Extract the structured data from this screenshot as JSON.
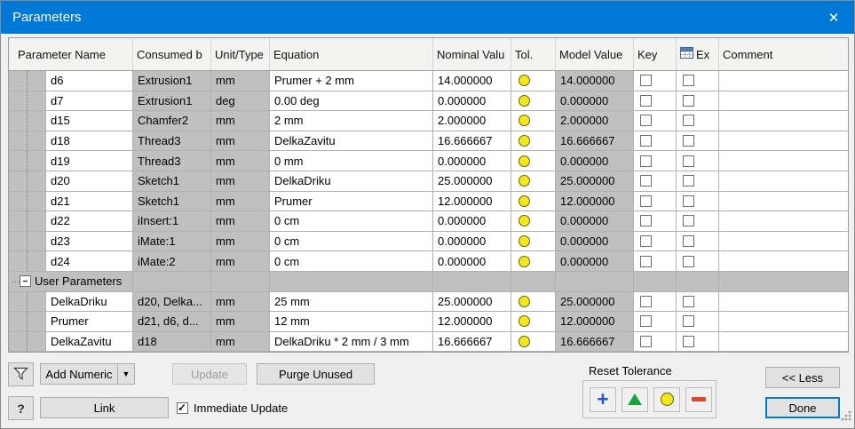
{
  "window": {
    "title": "Parameters",
    "close_glyph": "✕"
  },
  "colors": {
    "accent_blue": "#0078d7",
    "readonly_cell_gray": "#c0c0c0",
    "tolerance_yellow": "#f5e71e",
    "reset_plus_blue": "#2456cf",
    "reset_triangle_green": "#18a43a",
    "reset_minus_red": "#e2442c"
  },
  "icons": {
    "close": "close-icon",
    "filter": "funnel-icon",
    "help": "question-icon",
    "dropdown": "chevron-down-icon",
    "export_header": "export-table-icon",
    "tolerance": "yellow-circle-icon",
    "resize": "resize-grip-icon"
  },
  "table": {
    "headers": {
      "name": "Parameter Name",
      "consumed": "Consumed b",
      "unit": "Unit/Type",
      "equation": "Equation",
      "nominal": "Nominal Valu",
      "tol": "Tol.",
      "model": "Model Value",
      "key": "Key",
      "export": "Ex",
      "comment": "Comment"
    },
    "rows": [
      {
        "type": "param",
        "name": "d6",
        "consumed": "Extrusion1",
        "unit": "mm",
        "equation": "Prumer + 2 mm",
        "nominal": "14.000000",
        "tol": "yellow",
        "model": "14.000000",
        "key": false,
        "export": false,
        "comment": ""
      },
      {
        "type": "param",
        "name": "d7",
        "consumed": "Extrusion1",
        "unit": "deg",
        "equation": "0.00 deg",
        "nominal": "0.000000",
        "tol": "yellow",
        "model": "0.000000",
        "key": false,
        "export": false,
        "comment": ""
      },
      {
        "type": "param",
        "name": "d15",
        "consumed": "Chamfer2",
        "unit": "mm",
        "equation": "2 mm",
        "nominal": "2.000000",
        "tol": "yellow",
        "model": "2.000000",
        "key": false,
        "export": false,
        "comment": ""
      },
      {
        "type": "param",
        "name": "d18",
        "consumed": "Thread3",
        "unit": "mm",
        "equation": "DelkaZavitu",
        "nominal": "16.666667",
        "tol": "yellow",
        "model": "16.666667",
        "key": false,
        "export": false,
        "comment": ""
      },
      {
        "type": "param",
        "name": "d19",
        "consumed": "Thread3",
        "unit": "mm",
        "equation": "0 mm",
        "nominal": "0.000000",
        "tol": "yellow",
        "model": "0.000000",
        "key": false,
        "export": false,
        "comment": ""
      },
      {
        "type": "param",
        "name": "d20",
        "consumed": "Sketch1",
        "unit": "mm",
        "equation": "DelkaDriku",
        "nominal": "25.000000",
        "tol": "yellow",
        "model": "25.000000",
        "key": false,
        "export": false,
        "comment": ""
      },
      {
        "type": "param",
        "name": "d21",
        "consumed": "Sketch1",
        "unit": "mm",
        "equation": "Prumer",
        "nominal": "12.000000",
        "tol": "yellow",
        "model": "12.000000",
        "key": false,
        "export": false,
        "comment": ""
      },
      {
        "type": "param",
        "name": "d22",
        "consumed": "iInsert:1",
        "unit": "mm",
        "equation": "0 cm",
        "nominal": "0.000000",
        "tol": "yellow",
        "model": "0.000000",
        "key": false,
        "export": false,
        "comment": ""
      },
      {
        "type": "param",
        "name": "d23",
        "consumed": "iMate:1",
        "unit": "mm",
        "equation": "0 cm",
        "nominal": "0.000000",
        "tol": "yellow",
        "model": "0.000000",
        "key": false,
        "export": false,
        "comment": ""
      },
      {
        "type": "param",
        "name": "d24",
        "consumed": "iMate:2",
        "unit": "mm",
        "equation": "0 cm",
        "nominal": "0.000000",
        "tol": "yellow",
        "model": "0.000000",
        "key": false,
        "export": false,
        "comment": ""
      },
      {
        "type": "group",
        "name": "User Parameters",
        "expander": "-"
      },
      {
        "type": "param",
        "name": "DelkaDriku",
        "consumed": "d20, Delka...",
        "unit": "mm",
        "equation": "25 mm",
        "nominal": "25.000000",
        "tol": "yellow",
        "model": "25.000000",
        "key": false,
        "export": false,
        "comment": ""
      },
      {
        "type": "param",
        "name": "Prumer",
        "consumed": "d21, d6, d...",
        "unit": "mm",
        "equation": "12 mm",
        "nominal": "12.000000",
        "tol": "yellow",
        "model": "12.000000",
        "key": false,
        "export": false,
        "comment": ""
      },
      {
        "type": "param",
        "name": "DelkaZavitu",
        "consumed": "d18",
        "unit": "mm",
        "equation": "DelkaDriku * 2 mm / 3 mm",
        "nominal": "16.666667",
        "tol": "yellow",
        "model": "16.666667",
        "key": false,
        "export": false,
        "comment": ""
      }
    ]
  },
  "footer": {
    "add_numeric_label": "Add Numeric",
    "dropdown_glyph": "▼",
    "update_label": "Update",
    "purge_unused_label": "Purge Unused",
    "reset_tolerance_label": "Reset Tolerance",
    "less_label": "<< Less",
    "help_label": "?",
    "link_label": "Link",
    "immediate_update_label": "Immediate Update",
    "immediate_update_checked": true,
    "done_label": "Done"
  }
}
